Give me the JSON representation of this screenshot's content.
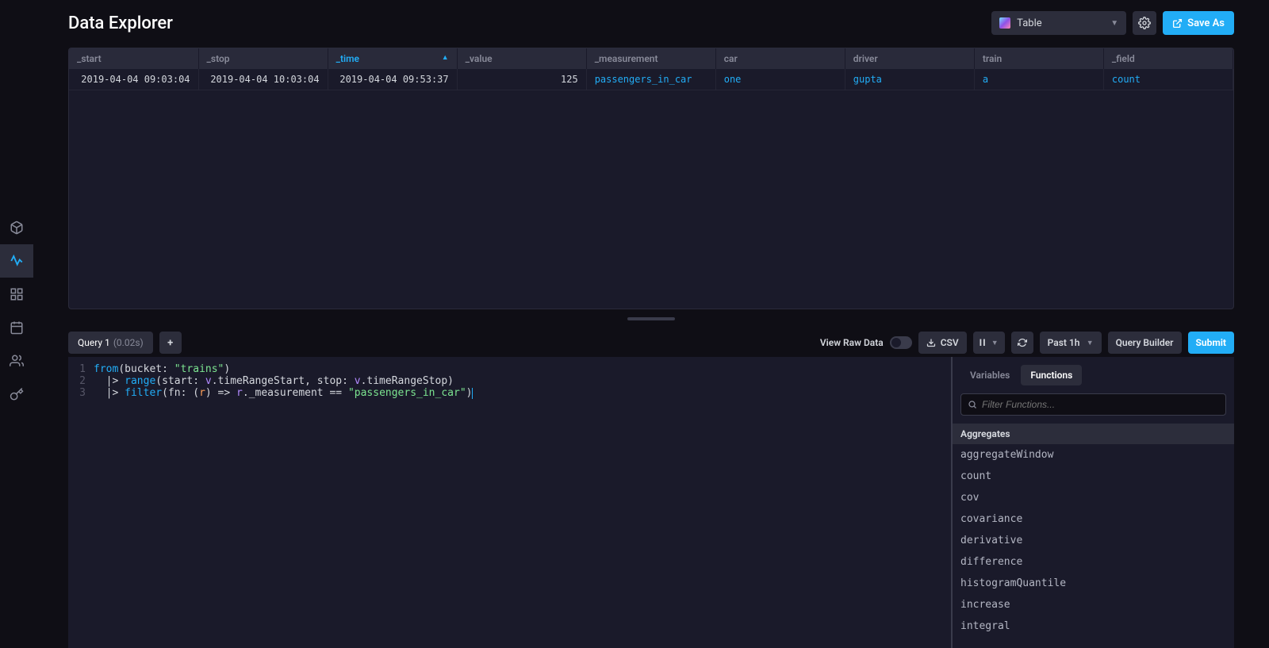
{
  "header": {
    "title": "Data Explorer",
    "visualization_label": "Table",
    "save_as_label": "Save As"
  },
  "nav_items": [
    {
      "name": "cube-icon"
    },
    {
      "name": "explore-icon",
      "active": true
    },
    {
      "name": "grid-icon"
    },
    {
      "name": "calendar-icon"
    },
    {
      "name": "people-icon"
    },
    {
      "name": "key-icon"
    }
  ],
  "table": {
    "sort_col": "_time",
    "columns": [
      "_start",
      "_stop",
      "_time",
      "_value",
      "_measurement",
      "car",
      "driver",
      "train",
      "_field"
    ],
    "rows": [
      {
        "_start": "2019-04-04 09:03:04",
        "_stop": "2019-04-04 10:03:04",
        "_time": "2019-04-04 09:53:37",
        "_value": "125",
        "_measurement": "passengers_in_car",
        "car": "one",
        "driver": "gupta",
        "train": "a",
        "_field": "count"
      }
    ]
  },
  "query_tab": {
    "name": "Query 1",
    "timing": "(0.02s)"
  },
  "toolbar": {
    "raw": "View Raw Data",
    "csv": "CSV",
    "range": "Past 1h",
    "builder": "Query Builder",
    "submit": "Submit"
  },
  "editor_lines": [
    [
      {
        "t": "kw",
        "v": "from"
      },
      {
        "t": "plain",
        "v": "(bucket: "
      },
      {
        "t": "str",
        "v": "\"trains\""
      },
      {
        "t": "plain",
        "v": ")"
      }
    ],
    [
      {
        "t": "plain",
        "v": "  |> "
      },
      {
        "t": "kw",
        "v": "range"
      },
      {
        "t": "plain",
        "v": "(start: "
      },
      {
        "t": "var",
        "v": "v"
      },
      {
        "t": "plain",
        "v": ".timeRangeStart, stop: "
      },
      {
        "t": "var",
        "v": "v"
      },
      {
        "t": "plain",
        "v": ".timeRangeStop)"
      }
    ],
    [
      {
        "t": "plain",
        "v": "  |> "
      },
      {
        "t": "kw",
        "v": "filter"
      },
      {
        "t": "plain",
        "v": "(fn: ("
      },
      {
        "t": "param",
        "v": "r"
      },
      {
        "t": "plain",
        "v": ") => "
      },
      {
        "t": "var",
        "v": "r"
      },
      {
        "t": "plain",
        "v": "._measurement == "
      },
      {
        "t": "str",
        "v": "\"passengers_in_car\""
      },
      {
        "t": "plain",
        "v": ")"
      }
    ]
  ],
  "side_panel": {
    "tabs": [
      "Variables",
      "Functions"
    ],
    "active_tab": "Functions",
    "search_placeholder": "Filter Functions...",
    "group": "Aggregates",
    "functions": [
      "aggregateWindow",
      "count",
      "cov",
      "covariance",
      "derivative",
      "difference",
      "histogramQuantile",
      "increase",
      "integral"
    ]
  }
}
